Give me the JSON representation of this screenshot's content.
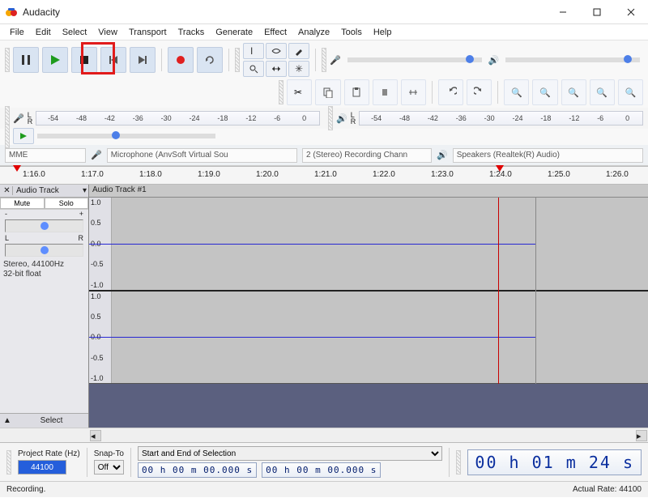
{
  "window": {
    "title": "Audacity"
  },
  "menu": [
    "File",
    "Edit",
    "Select",
    "View",
    "Transport",
    "Tracks",
    "Generate",
    "Effect",
    "Analyze",
    "Tools",
    "Help"
  ],
  "transport": {
    "buttons": [
      "pause",
      "play",
      "stop",
      "skip-start",
      "skip-end",
      "record",
      "loop"
    ]
  },
  "devices": {
    "host_label": "MME",
    "input_label": "Microphone (AnvSoft Virtual Sou",
    "channels_label": "2 (Stereo) Recording Chann",
    "output_label": "Speakers (Realtek(R) Audio)"
  },
  "meter": {
    "ticks": [
      "-54",
      "-48",
      "-42",
      "-36",
      "-30",
      "-24",
      "-18",
      "-12",
      "-6",
      "0"
    ]
  },
  "timeline": {
    "start_label": "1:16.0",
    "ticks": [
      "1:16.0",
      "1:17.0",
      "1:18.0",
      "1:19.0",
      "1:20.0",
      "1:21.0",
      "1:22.0",
      "1:23.0",
      "1:24.0",
      "1:25.0",
      "1:26.0"
    ],
    "play_cursor_label": "1:24.0"
  },
  "track": {
    "dropdown_label": "Audio Track",
    "name": "Audio Track #1",
    "mute": "Mute",
    "solo": "Solo",
    "pan_left": "L",
    "pan_right": "R",
    "info1": "Stereo, 44100Hz",
    "info2": "32-bit float",
    "select_footer": "Select",
    "scale": [
      "1.0",
      "0.5",
      "0.0",
      "-0.5",
      "-1.0"
    ]
  },
  "selection_toolbar": {
    "project_rate_label": "Project Rate (Hz)",
    "project_rate": "44100",
    "snap_label": "Snap-To",
    "snap_value": "Off",
    "mode_label": "Start and End of Selection",
    "start_tc": "00 h 00 m 00.000 s",
    "end_tc": "00 h 00 m 00.000 s",
    "big_time": "00 h 01 m 24 s"
  },
  "status": {
    "left": "Recording.",
    "right": "Actual Rate: 44100"
  }
}
